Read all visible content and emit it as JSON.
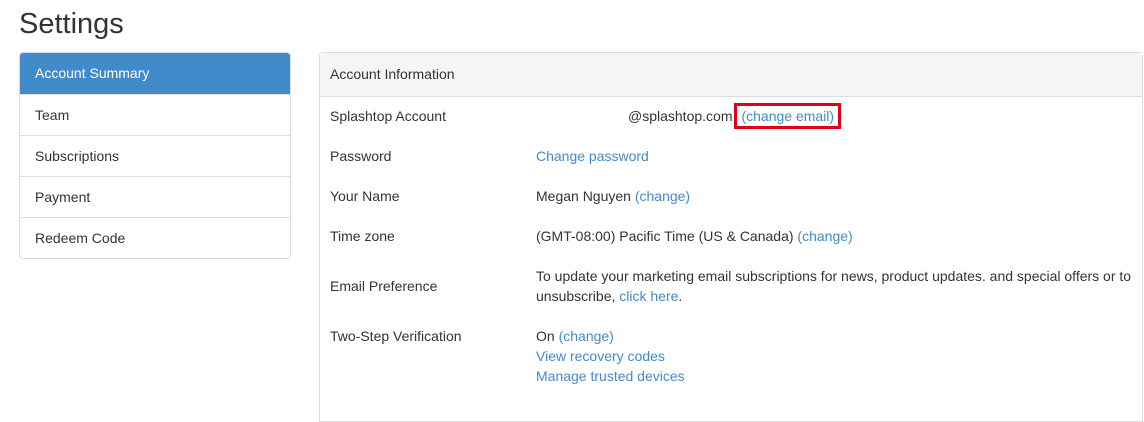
{
  "page": {
    "title": "Settings"
  },
  "sidebar": {
    "items": [
      {
        "label": "Account Summary"
      },
      {
        "label": "Team"
      },
      {
        "label": "Subscriptions"
      },
      {
        "label": "Payment"
      },
      {
        "label": "Redeem Code"
      }
    ]
  },
  "panel": {
    "heading": "Account Information",
    "account": {
      "label": "Splashtop Account",
      "email_domain": "@splashtop.com",
      "change_email": "(change email)"
    },
    "password": {
      "label": "Password",
      "change_link": "Change password"
    },
    "name": {
      "label": "Your Name",
      "value": "Megan Nguyen",
      "change_link": "(change)"
    },
    "timezone": {
      "label": "Time zone",
      "value": "(GMT-08:00) Pacific Time (US & Canada)",
      "change_link": "(change)"
    },
    "email_pref": {
      "label": "Email Preference",
      "text": "To update your marketing email subscriptions for news, product updates. and special offers or to unsubscribe,",
      "link": "click here",
      "suffix": "."
    },
    "two_step": {
      "label": "Two-Step Verification",
      "status": "On",
      "change_link": "(change)",
      "recovery_link": "View recovery codes",
      "trusted_link": "Manage trusted devices"
    }
  },
  "colors": {
    "accent": "#428bca",
    "highlight_border": "#e0001b",
    "panel_heading_bg": "#f5f5f5"
  }
}
